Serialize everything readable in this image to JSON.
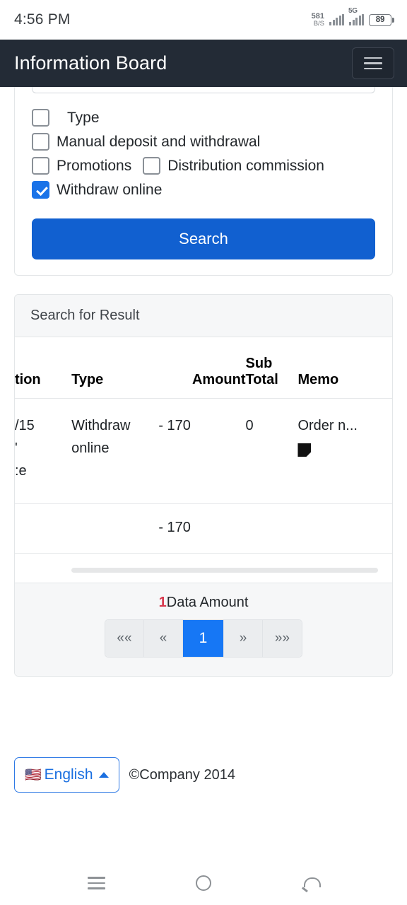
{
  "status_bar": {
    "time": "4:56 PM",
    "net_speed_value": "581",
    "net_speed_unit": "B/S",
    "network_type": "5G",
    "battery_level": "89"
  },
  "header": {
    "title": "Information Board",
    "menu_icon": "hamburger-icon"
  },
  "search_panel": {
    "checkboxes": [
      {
        "label": "Type",
        "checked": false,
        "indent": true
      },
      {
        "label": "Manual deposit and withdrawal",
        "checked": false,
        "indent": false
      },
      {
        "label": "Promotions",
        "checked": false,
        "indent": false
      },
      {
        "label": "Distribution commission",
        "checked": false,
        "indent": false
      },
      {
        "label": "Withdraw online",
        "checked": true,
        "indent": false
      }
    ],
    "search_button": "Search"
  },
  "result_panel": {
    "title": "Search for Result",
    "columns": {
      "date": "tion",
      "type": "Type",
      "amount": "Amount",
      "sub_total_line1": "Sub",
      "sub_total_line2": "Total",
      "memo": "Memo"
    },
    "rows": [
      {
        "date_line1": "/15",
        "date_line2": "'",
        "date_line3": ":e",
        "type": "Withdraw online",
        "amount": "- 170",
        "sub_total": "0",
        "memo": "Order n...",
        "memo_icon": "note-icon"
      }
    ],
    "footer_total": "- 170"
  },
  "pagination": {
    "count_value": "1",
    "count_label": "Data Amount",
    "buttons": [
      {
        "label": "««",
        "active": false,
        "name": "first-page"
      },
      {
        "label": "«",
        "active": false,
        "name": "prev-page"
      },
      {
        "label": "1",
        "active": true,
        "name": "page-1"
      },
      {
        "label": "»",
        "active": false,
        "name": "next-page"
      },
      {
        "label": "»»",
        "active": false,
        "name": "last-page"
      }
    ]
  },
  "site_footer": {
    "flag": "🇺🇸",
    "language": "English",
    "copyright": "©Company 2014"
  },
  "android_nav": {
    "recent": "recent-apps-icon",
    "home": "home-icon",
    "back": "back-icon"
  },
  "colors": {
    "header_bg": "#232b36",
    "primary": "#1160d0",
    "accent_blue": "#1677f5",
    "negative": "#d7394e"
  }
}
